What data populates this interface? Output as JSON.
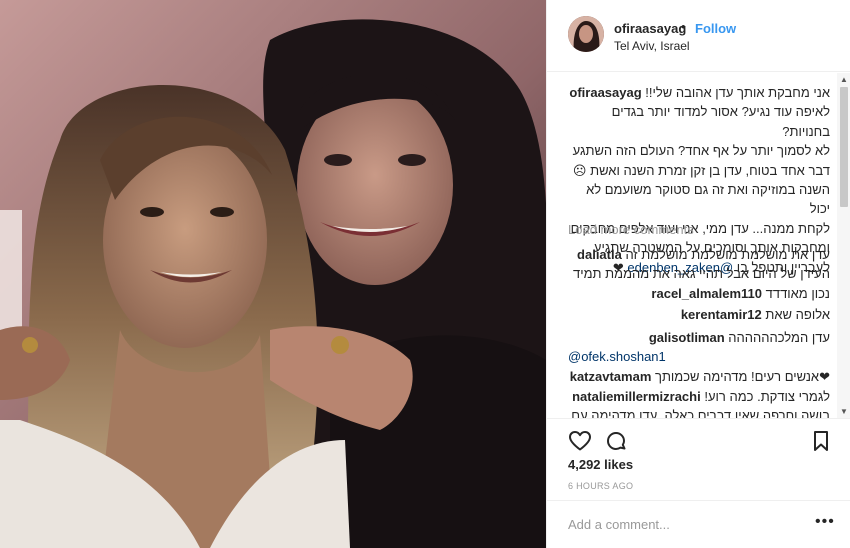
{
  "post": {
    "username": "ofiraasayag",
    "separator": "•",
    "follow_label": "Follow",
    "location": "Tel Aviv, Israel"
  },
  "caption": {
    "username": "ofiraasayag",
    "lines": [
      "אני מחבקת אותך עדן אהובה שלי!!",
      "לאיפה עוד נגיע? אסור למדוד יותר בגדים בחנויות?",
      "לא לסמוך יותר על אף אחד? העולם הזה השתגע",
      "דבר אחד בטוח, עדן בן זקן זמרת השנה ואשת ☹",
      "השנה במוזיקה ואת זה גם סטוקר משועמם לא יכול",
      "לקחת ממנה... עדן ממי, אני ועוד אלפים מחבקים",
      "ומחבקות אותך וסומכים על המשטרה שתגיע"
    ],
    "last_line_text": "לעבריין ותטפל בו",
    "last_line_mention": "@edenben_zaken",
    "last_line_emoji": "❤"
  },
  "load_more_label": "Load more comments",
  "comments": [
    {
      "user": "daliatla",
      "lines": [
        "עדן את מושלמת מושלמת מושלמת זה",
        "העידן של היום אבל תהיי גאה את מהממת תמיד"
      ]
    },
    {
      "user": "racel_almalem110",
      "lines": [
        "נכון מאודדד"
      ]
    },
    {
      "user": "kerentamir12",
      "lines": [
        "אלופה שאת"
      ]
    },
    {
      "user": "galisotliman",
      "lines": [
        "עדן המלכהההההה"
      ],
      "mention": "@ofek.shoshan1"
    },
    {
      "user": "katzavtamam",
      "lines": [
        "❤אנשים רעים! מדהימה שכמותך"
      ]
    },
    {
      "user": "nataliemillermizrachi",
      "lines": [
        "לגמרי צודקת. כמה רוע!",
        "בושה וחרפה שאיו דברים כאלה. עדן מדהימה עם"
      ]
    }
  ],
  "icons": {
    "like": "heart-outline-icon",
    "comment": "speech-bubble-icon",
    "save": "bookmark-outline-icon",
    "options": "ellipsis-icon"
  },
  "likes_label": "4,292 likes",
  "time_label": "6 HOURS AGO",
  "add_comment": {
    "placeholder": "Add a comment...",
    "more_label": "•••"
  },
  "colors": {
    "accent": "#3897f0",
    "mention": "#003569",
    "muted": "#999999",
    "text": "#262626"
  }
}
